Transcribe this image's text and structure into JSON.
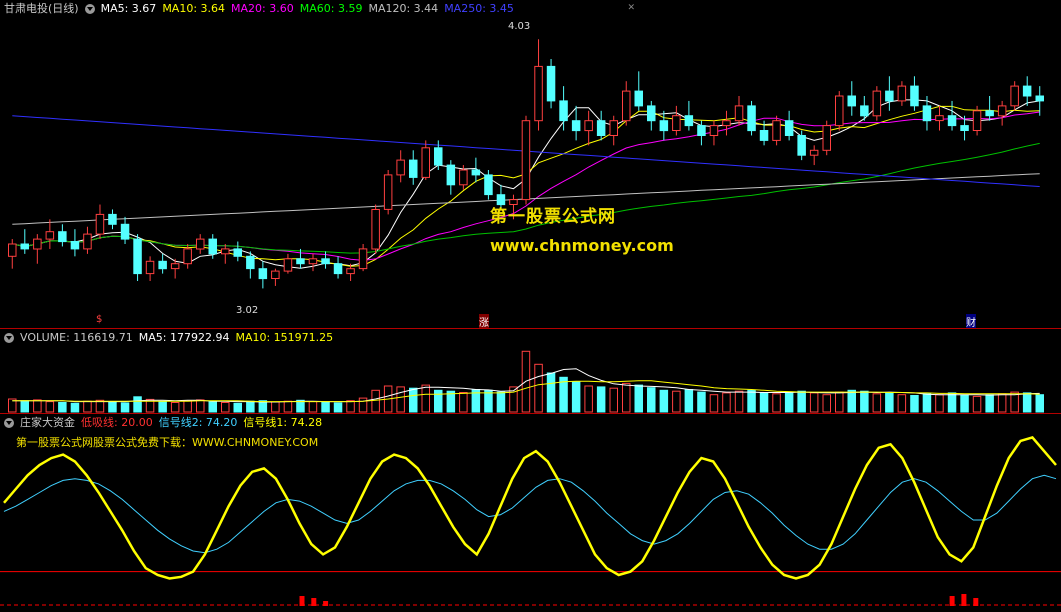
{
  "price_header": {
    "title": "甘肃电投(日线)",
    "ma5": "MA5: 3.67",
    "ma10": "MA10: 3.64",
    "ma20": "MA20: 3.60",
    "ma60": "MA60: 3.59",
    "ma120": "MA120: 3.44",
    "ma250": "MA250: 3.45"
  },
  "price_annotations": {
    "high": "4.03",
    "low": "3.02",
    "marker_a": "$",
    "marker_b": "涨",
    "marker_c": "财"
  },
  "watermark": {
    "name": "第一股票公式网",
    "url": "www.chnmoney.com"
  },
  "volume_header": {
    "volume": "VOLUME: 116619.71",
    "ma5": "MA5: 177922.94",
    "ma10": "MA10: 151971.25"
  },
  "indicator_header": {
    "name": "庄家大资金",
    "low_line": "低吸线: 20.00",
    "signal2": "信号线2: 74.20",
    "signal1": "信号线1: 74.28",
    "promo": "第一股票公式网股票公式免费下载：WWW.CHNMONEY.COM"
  },
  "colors": {
    "up": "#ff4040",
    "down": "#54ffff",
    "ma5": "#ffffff",
    "ma10": "#ffff00",
    "ma20": "#ff00ff",
    "ma60": "#00c000",
    "ma120": "#c0c0c0",
    "ma250": "#3030ff",
    "signal1": "#ffff00",
    "signal2": "#40d0ff",
    "low_line": "#ff0000"
  },
  "chart_data": [
    {
      "type": "candlestick",
      "title": "甘肃电投(日线)",
      "ylim": [
        2.9,
        4.1
      ],
      "candles": [
        [
          3.15,
          3.22,
          3.1,
          3.2
        ],
        [
          3.2,
          3.26,
          3.16,
          3.18
        ],
        [
          3.18,
          3.24,
          3.12,
          3.22
        ],
        [
          3.22,
          3.3,
          3.18,
          3.25
        ],
        [
          3.25,
          3.28,
          3.19,
          3.21
        ],
        [
          3.21,
          3.26,
          3.15,
          3.18
        ],
        [
          3.18,
          3.27,
          3.16,
          3.24
        ],
        [
          3.24,
          3.36,
          3.22,
          3.32
        ],
        [
          3.32,
          3.34,
          3.26,
          3.28
        ],
        [
          3.28,
          3.31,
          3.2,
          3.22
        ],
        [
          3.22,
          3.24,
          3.05,
          3.08
        ],
        [
          3.08,
          3.15,
          3.05,
          3.13
        ],
        [
          3.13,
          3.16,
          3.08,
          3.1
        ],
        [
          3.1,
          3.14,
          3.06,
          3.12
        ],
        [
          3.12,
          3.2,
          3.1,
          3.18
        ],
        [
          3.18,
          3.24,
          3.16,
          3.22
        ],
        [
          3.22,
          3.24,
          3.14,
          3.16
        ],
        [
          3.16,
          3.2,
          3.12,
          3.18
        ],
        [
          3.18,
          3.21,
          3.13,
          3.15
        ],
        [
          3.15,
          3.17,
          3.06,
          3.1
        ],
        [
          3.1,
          3.13,
          3.02,
          3.06
        ],
        [
          3.06,
          3.1,
          3.03,
          3.09
        ],
        [
          3.09,
          3.16,
          3.08,
          3.14
        ],
        [
          3.14,
          3.18,
          3.1,
          3.12
        ],
        [
          3.12,
          3.16,
          3.09,
          3.14
        ],
        [
          3.14,
          3.17,
          3.1,
          3.12
        ],
        [
          3.12,
          3.15,
          3.06,
          3.08
        ],
        [
          3.08,
          3.12,
          3.05,
          3.1
        ],
        [
          3.1,
          3.2,
          3.09,
          3.18
        ],
        [
          3.18,
          3.36,
          3.16,
          3.34
        ],
        [
          3.34,
          3.5,
          3.32,
          3.48
        ],
        [
          3.48,
          3.58,
          3.45,
          3.54
        ],
        [
          3.54,
          3.58,
          3.44,
          3.47
        ],
        [
          3.47,
          3.62,
          3.46,
          3.59
        ],
        [
          3.59,
          3.62,
          3.5,
          3.52
        ],
        [
          3.52,
          3.54,
          3.4,
          3.44
        ],
        [
          3.44,
          3.52,
          3.42,
          3.5
        ],
        [
          3.5,
          3.55,
          3.45,
          3.48
        ],
        [
          3.48,
          3.5,
          3.38,
          3.4
        ],
        [
          3.4,
          3.44,
          3.34,
          3.36
        ],
        [
          3.36,
          3.4,
          3.3,
          3.38
        ],
        [
          3.38,
          3.72,
          3.36,
          3.7
        ],
        [
          3.7,
          4.03,
          3.66,
          3.92
        ],
        [
          3.92,
          3.95,
          3.75,
          3.78
        ],
        [
          3.78,
          3.84,
          3.66,
          3.7
        ],
        [
          3.7,
          3.76,
          3.62,
          3.66
        ],
        [
          3.66,
          3.74,
          3.6,
          3.7
        ],
        [
          3.7,
          3.74,
          3.62,
          3.64
        ],
        [
          3.64,
          3.72,
          3.6,
          3.7
        ],
        [
          3.7,
          3.86,
          3.68,
          3.82
        ],
        [
          3.82,
          3.9,
          3.74,
          3.76
        ],
        [
          3.76,
          3.78,
          3.66,
          3.7
        ],
        [
          3.7,
          3.74,
          3.62,
          3.66
        ],
        [
          3.66,
          3.76,
          3.64,
          3.72
        ],
        [
          3.72,
          3.78,
          3.66,
          3.68
        ],
        [
          3.68,
          3.7,
          3.6,
          3.64
        ],
        [
          3.64,
          3.7,
          3.6,
          3.68
        ],
        [
          3.68,
          3.74,
          3.64,
          3.7
        ],
        [
          3.7,
          3.8,
          3.68,
          3.76
        ],
        [
          3.76,
          3.78,
          3.64,
          3.66
        ],
        [
          3.66,
          3.7,
          3.6,
          3.62
        ],
        [
          3.62,
          3.72,
          3.6,
          3.7
        ],
        [
          3.7,
          3.74,
          3.62,
          3.64
        ],
        [
          3.64,
          3.66,
          3.54,
          3.56
        ],
        [
          3.56,
          3.6,
          3.52,
          3.58
        ],
        [
          3.58,
          3.7,
          3.56,
          3.68
        ],
        [
          3.68,
          3.82,
          3.66,
          3.8
        ],
        [
          3.8,
          3.86,
          3.72,
          3.76
        ],
        [
          3.76,
          3.8,
          3.7,
          3.72
        ],
        [
          3.72,
          3.84,
          3.7,
          3.82
        ],
        [
          3.82,
          3.88,
          3.74,
          3.78
        ],
        [
          3.78,
          3.86,
          3.76,
          3.84
        ],
        [
          3.84,
          3.88,
          3.74,
          3.76
        ],
        [
          3.76,
          3.8,
          3.66,
          3.7
        ],
        [
          3.7,
          3.76,
          3.66,
          3.72
        ],
        [
          3.72,
          3.78,
          3.66,
          3.68
        ],
        [
          3.68,
          3.72,
          3.62,
          3.66
        ],
        [
          3.66,
          3.76,
          3.64,
          3.74
        ],
        [
          3.74,
          3.8,
          3.7,
          3.72
        ],
        [
          3.72,
          3.78,
          3.68,
          3.76
        ],
        [
          3.76,
          3.86,
          3.74,
          3.84
        ],
        [
          3.84,
          3.88,
          3.76,
          3.8
        ],
        [
          3.8,
          3.84,
          3.72,
          3.78
        ]
      ],
      "annotations": [
        "4.03",
        "3.02"
      ]
    },
    {
      "type": "bar",
      "title": "VOLUME",
      "values": [
        30,
        26,
        28,
        24,
        22,
        20,
        25,
        27,
        23,
        21,
        35,
        29,
        24,
        22,
        26,
        28,
        24,
        22,
        20,
        25,
        26,
        23,
        25,
        27,
        24,
        22,
        21,
        26,
        32,
        50,
        60,
        58,
        55,
        62,
        50,
        48,
        45,
        52,
        50,
        46,
        58,
        140,
        110,
        90,
        80,
        70,
        60,
        58,
        55,
        66,
        62,
        56,
        50,
        48,
        52,
        46,
        40,
        44,
        48,
        50,
        44,
        42,
        46,
        48,
        44,
        40,
        46,
        50,
        48,
        42,
        44,
        40,
        38,
        42,
        40,
        44,
        38,
        36,
        40,
        42,
        46,
        44,
        40
      ],
      "series": [
        {
          "name": "MA5",
          "values": [
            26,
            26,
            26,
            26,
            26,
            24,
            24,
            24,
            24,
            24,
            26,
            27,
            27,
            26,
            27,
            27,
            25,
            25,
            24,
            24,
            23,
            23,
            24,
            25,
            25,
            24,
            24,
            24,
            25,
            30,
            37,
            45,
            52,
            57,
            57,
            56,
            55,
            52,
            51,
            48,
            49,
            71,
            82,
            89,
            98,
            100,
            84,
            73,
            65,
            62,
            60,
            59,
            58,
            56,
            52,
            50,
            48,
            46,
            46,
            46,
            45,
            45,
            45,
            46,
            45,
            44,
            44,
            45,
            46,
            45,
            46,
            45,
            44,
            41,
            40,
            40,
            40,
            40,
            39,
            40,
            40,
            42,
            43
          ]
        },
        {
          "name": "MA10",
          "values": [
            26,
            26,
            26,
            26,
            26,
            25,
            25,
            25,
            25,
            25,
            25,
            25,
            25,
            25,
            25,
            26,
            26,
            26,
            26,
            25,
            24,
            24,
            24,
            24,
            24,
            24,
            24,
            24,
            25,
            27,
            30,
            34,
            38,
            41,
            41,
            42,
            43,
            44,
            44,
            44,
            46,
            55,
            63,
            66,
            70,
            71,
            71,
            70,
            70,
            71,
            72,
            72,
            69,
            66,
            63,
            60,
            56,
            54,
            53,
            52,
            50,
            48,
            47,
            46,
            46,
            46,
            46,
            46,
            46,
            46,
            45,
            45,
            44,
            44,
            43,
            43,
            42,
            42,
            42,
            42,
            42,
            42,
            41
          ]
        }
      ]
    },
    {
      "type": "line",
      "title": "庄家大资金",
      "ylim": [
        0,
        100
      ],
      "series": [
        {
          "name": "信号线1",
          "values": [
            60,
            68,
            76,
            82,
            86,
            88,
            84,
            76,
            66,
            55,
            44,
            32,
            22,
            18,
            16,
            17,
            20,
            30,
            44,
            58,
            70,
            78,
            80,
            74,
            62,
            48,
            36,
            30,
            34,
            46,
            60,
            74,
            84,
            88,
            86,
            80,
            70,
            58,
            46,
            36,
            30,
            42,
            58,
            74,
            86,
            90,
            84,
            72,
            58,
            44,
            30,
            22,
            18,
            20,
            26,
            38,
            52,
            66,
            78,
            86,
            84,
            74,
            60,
            46,
            34,
            24,
            18,
            16,
            18,
            24,
            36,
            52,
            68,
            82,
            92,
            94,
            86,
            72,
            56,
            40,
            30,
            26,
            34,
            52,
            70,
            86,
            96,
            98,
            90,
            82
          ]
        },
        {
          "name": "信号线2",
          "values": [
            55,
            58,
            62,
            66,
            70,
            73,
            74,
            73,
            71,
            67,
            62,
            56,
            50,
            44,
            39,
            35,
            32,
            31,
            33,
            37,
            43,
            49,
            55,
            60,
            62,
            61,
            58,
            54,
            50,
            48,
            50,
            55,
            61,
            67,
            71,
            73,
            73,
            71,
            67,
            62,
            56,
            52,
            53,
            57,
            63,
            69,
            73,
            74,
            72,
            67,
            61,
            54,
            48,
            42,
            38,
            36,
            38,
            42,
            48,
            55,
            62,
            66,
            67,
            65,
            60,
            54,
            47,
            41,
            36,
            33,
            33,
            36,
            42,
            50,
            58,
            66,
            72,
            74,
            72,
            67,
            61,
            55,
            50,
            50,
            54,
            61,
            68,
            74,
            76,
            74
          ]
        },
        {
          "name": "低吸线",
          "values": [
            20
          ]
        }
      ]
    }
  ]
}
